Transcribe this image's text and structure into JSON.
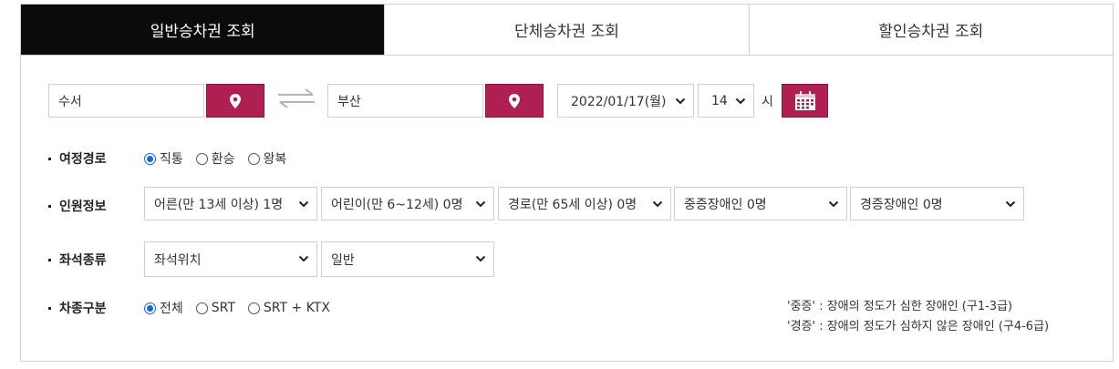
{
  "tabs": [
    {
      "label": "일반승차권 조회"
    },
    {
      "label": "단체승차권 조회"
    },
    {
      "label": "할인승차권 조회"
    }
  ],
  "route": {
    "departure": "수서",
    "arrival": "부산",
    "date": "2022/01/17(월)",
    "hour": "14",
    "hour_unit": "시"
  },
  "trip_type": {
    "label": "여정경로",
    "options": [
      "직통",
      "환승",
      "왕복"
    ],
    "selected": "직통"
  },
  "passengers": {
    "label": "인원정보",
    "selects": [
      "어른(만 13세 이상) 1명",
      "어린이(만 6~12세) 0명",
      "경로(만 65세 이상) 0명",
      "중증장애인 0명",
      "경증장애인 0명"
    ]
  },
  "seat": {
    "label": "좌석종류",
    "position": "좌석위치",
    "class": "일반"
  },
  "train_type": {
    "label": "차종구분",
    "options": [
      "전체",
      "SRT",
      "SRT + KTX"
    ],
    "selected": "전체"
  },
  "notes": [
    "'중증' : 장애의 정도가 심한 장애인 (구1-3급)",
    "'경증' : 장애의 정도가 심하지 않은 장애인 (구4-6급)"
  ],
  "colors": {
    "accent": "#b01f52",
    "active_tab": "#0b0b0b",
    "radio": "#1a66d6"
  },
  "icons": {
    "pin": "map-pin-icon",
    "swap": "swap-arrows-icon",
    "calendar": "calendar-icon",
    "chevron": "chevron-down-icon"
  }
}
